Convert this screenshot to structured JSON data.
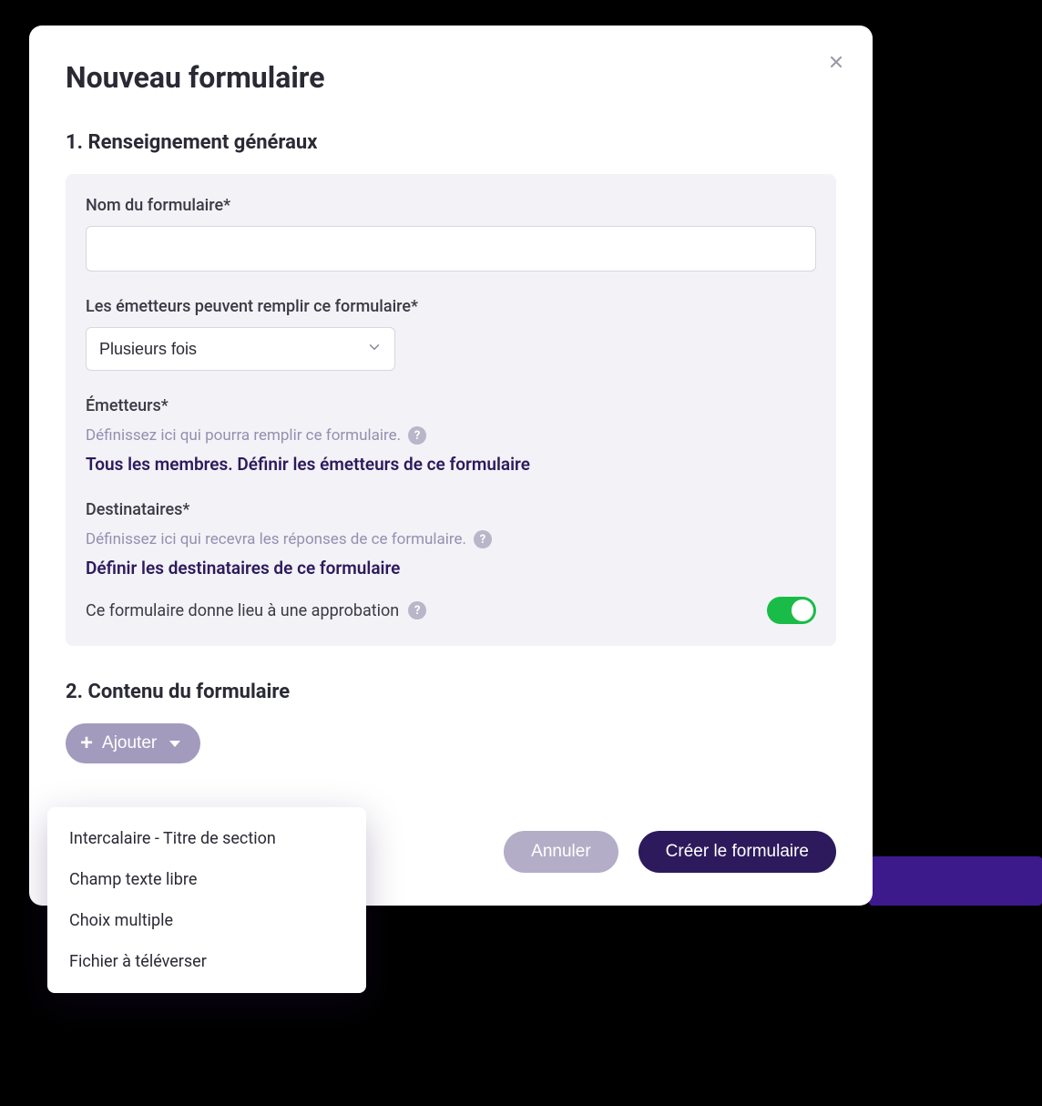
{
  "modal": {
    "title": "Nouveau formulaire"
  },
  "section1": {
    "title": "1. Renseignement généraux",
    "form_name_label": "Nom du formulaire*",
    "form_name_value": "",
    "emitters_fill_label": "Les émetteurs peuvent remplir ce formulaire*",
    "emitters_fill_value": "Plusieurs fois",
    "emitters_label": "Émetteurs*",
    "emitters_help": "Définissez ici qui pourra remplir ce formulaire.",
    "emitters_link": "Tous les membres. Définir les émetteurs de ce formulaire",
    "recipients_label": "Destinataires*",
    "recipients_help": "Définissez ici qui recevra les réponses de ce formulaire.",
    "recipients_link": "Définir les destinataires de ce formulaire",
    "approval_label": "Ce formulaire donne lieu à une approbation",
    "approval_on": true
  },
  "section2": {
    "title": "2. Contenu du formulaire",
    "add_button": "Ajouter",
    "menu_items": [
      "Intercalaire - Titre de section",
      "Champ texte libre",
      "Choix multiple",
      "Fichier à téléverser"
    ]
  },
  "footer": {
    "cancel": "Annuler",
    "create": "Créer le formulaire"
  }
}
